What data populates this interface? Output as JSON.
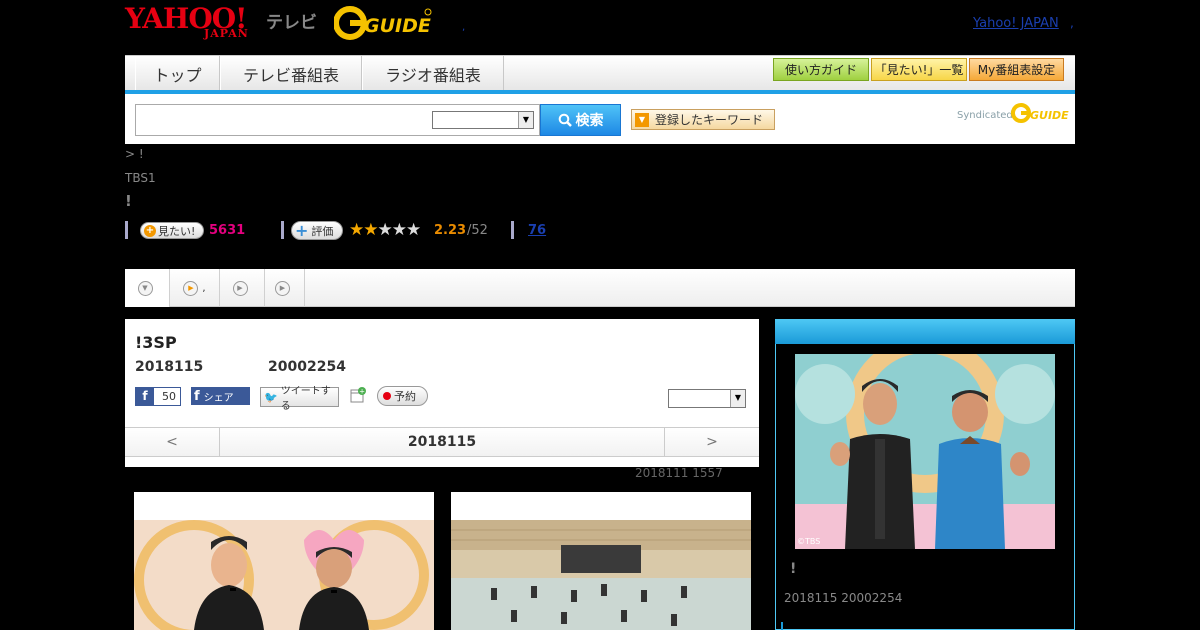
{
  "header": {
    "logo_yahoo": "YAHOO!",
    "logo_japan": "JAPAN",
    "logo_tv": "テレビ",
    "logo_gguide": "G GUIDE",
    "dot": ",",
    "yahoo_link": "Yahoo! JAPAN",
    "yahoo_link_dot": ","
  },
  "nav": {
    "tabs": [
      "トップ",
      "テレビ番組表",
      "ラジオ番組表"
    ],
    "buttons": [
      "使い方ガイド",
      "「見たい!」一覧",
      "My番組表設定"
    ]
  },
  "search": {
    "input_value": "",
    "select_value": "",
    "button_label": "検索",
    "keyword_button": "登録したキーワード",
    "syndicated": "Syndicated",
    "syndicated_logo": "G GUIDE"
  },
  "program": {
    "breadcrumb": "> !",
    "channel": "TBS1",
    "title": "!",
    "mitai_label": "見たい!",
    "mitai_count": "5631",
    "hyoka_label": "評価",
    "stars_filled": 2,
    "stars_total": 5,
    "rating": "2.23",
    "rating_count": "/52",
    "review_count": "76"
  },
  "tabs": [
    {
      "label": ""
    },
    {
      "label": ","
    },
    {
      "label": ""
    },
    {
      "label": ""
    }
  ],
  "detail": {
    "title": "!3SP",
    "date": "2018115",
    "time": "20002254",
    "fb_like": "50",
    "fb_share": "シェア",
    "tweet": "ツイートする",
    "reserve": "予約",
    "pager_prev": "<",
    "pager_date": "2018115",
    "pager_next": ">",
    "updated": "2018111  1557"
  },
  "sidebar": {
    "copyright": "©TBS",
    "title": "!",
    "date": "2018115  20002254"
  },
  "colors": {
    "accent_blue": "#1fa0e6",
    "yahoo_red": "#e60012",
    "mitai_pink": "#e4007f",
    "rating_orange": "#e98b00"
  }
}
